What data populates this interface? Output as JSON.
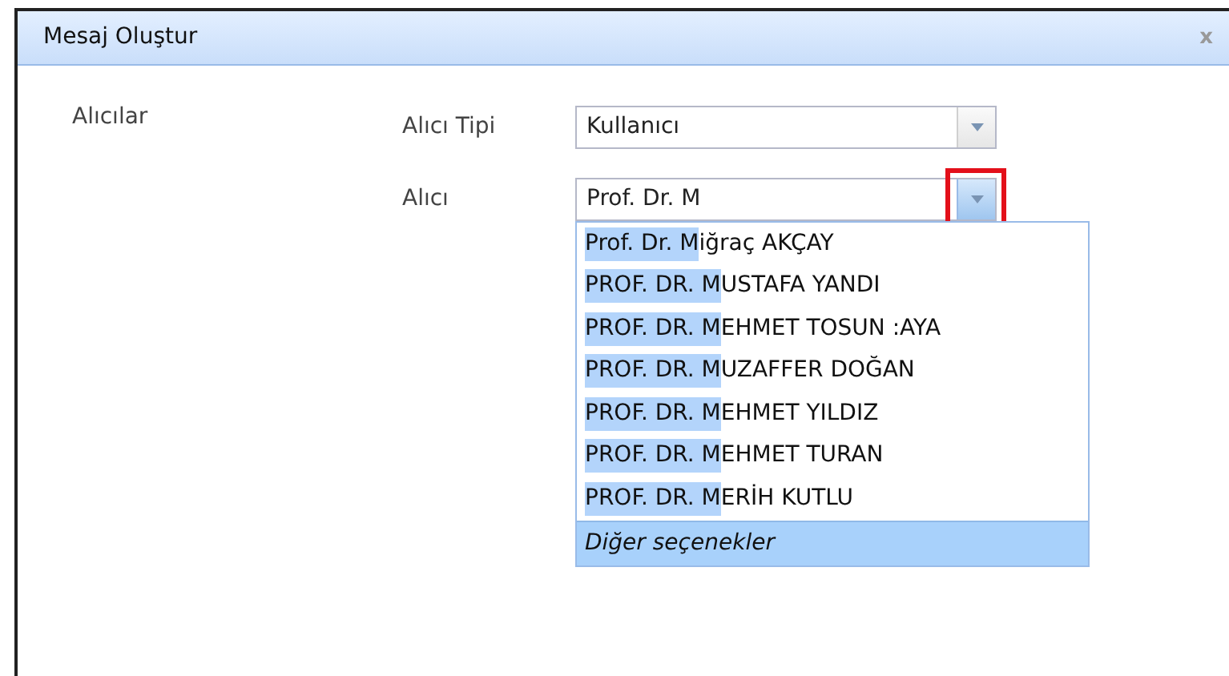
{
  "window": {
    "title": "Mesaj Oluştur",
    "close": "x"
  },
  "section_label": "Alıcılar",
  "fields": [
    {
      "label": "Alıcı Tipi",
      "value": "Kullanıcı",
      "highlighted": false
    },
    {
      "label": "Alıcı",
      "value": "Prof. Dr. M",
      "highlighted": true
    }
  ],
  "dropdown": {
    "items": [
      {
        "match": "Prof. Dr. M",
        "rest": "iğraç AKÇAY"
      },
      {
        "match": "PROF. DR. M",
        "rest": "USTAFA YANDI"
      },
      {
        "match": "PROF. DR. M",
        "rest": "EHMET TOSUN :AYA"
      },
      {
        "match": "PROF. DR. M",
        "rest": "UZAFFER DOĞAN"
      },
      {
        "match": "PROF. DR. M",
        "rest": "EHMET YILDIZ"
      },
      {
        "match": "PROF. DR. M",
        "rest": "EHMET TURAN"
      },
      {
        "match": "PROF. DR. M",
        "rest": "ERİH KUTLU"
      }
    ],
    "more": {
      "label": "Diğer seçenekler",
      "selected": true
    }
  }
}
